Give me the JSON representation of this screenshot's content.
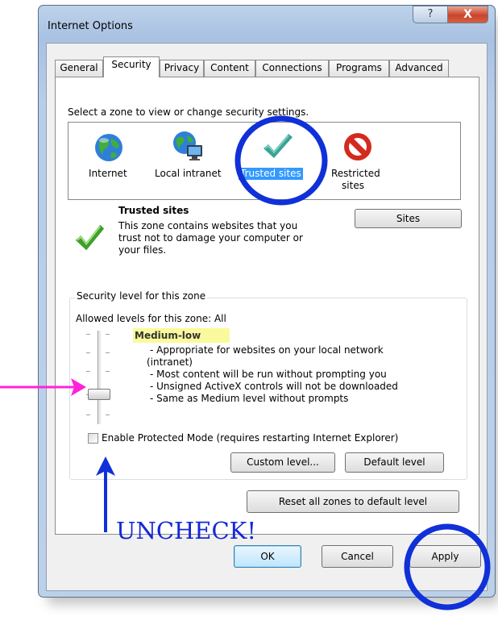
{
  "window": {
    "title": "Internet Options",
    "help_glyph": "?",
    "close_glyph": "X"
  },
  "tabs": [
    {
      "label": "General"
    },
    {
      "label": "Security"
    },
    {
      "label": "Privacy"
    },
    {
      "label": "Content"
    },
    {
      "label": "Connections"
    },
    {
      "label": "Programs"
    },
    {
      "label": "Advanced"
    }
  ],
  "security": {
    "zone_prompt": "Select a zone to view or change security settings.",
    "zones": [
      {
        "label": "Internet",
        "icon": "globe-icon"
      },
      {
        "label": "Local intranet",
        "icon": "intranet-icon"
      },
      {
        "label": "Trusted sites",
        "icon": "checkmark-icon",
        "selected": true
      },
      {
        "label_line1": "Restricted",
        "label_line2": "sites",
        "icon": "prohibited-icon"
      }
    ],
    "selected_zone": {
      "name": "Trusted sites",
      "desc_line1": "This zone contains websites that you",
      "desc_line2": "trust not to damage your computer or",
      "desc_line3": "your files."
    },
    "sites_button": "Sites",
    "level_group_title": "Security level for this zone",
    "allowed_levels": "Allowed levels for this zone: All",
    "level_name": "Medium-low",
    "level_notes": [
      "- Appropriate for websites on your local network",
      "(intranet)",
      "- Most content will be run without prompting you",
      "- Unsigned ActiveX controls will not be downloaded",
      "- Same as Medium level without prompts"
    ],
    "protected_mode": {
      "label": "Enable Protected Mode (requires restarting Internet Explorer)",
      "checked": false
    },
    "custom_level_button": "Custom level...",
    "default_level_button": "Default level",
    "reset_zones_button": "Reset all zones to default level"
  },
  "footer": {
    "ok": "OK",
    "cancel": "Cancel",
    "apply": "Apply"
  },
  "annotations": {
    "uncheck_text": "UNCHECK!",
    "circle_color": "#1030d8",
    "magenta_arrow_color": "#ff22dd"
  },
  "colors": {
    "selection": "#3399ff",
    "level_highlight": "#fafa9c"
  }
}
